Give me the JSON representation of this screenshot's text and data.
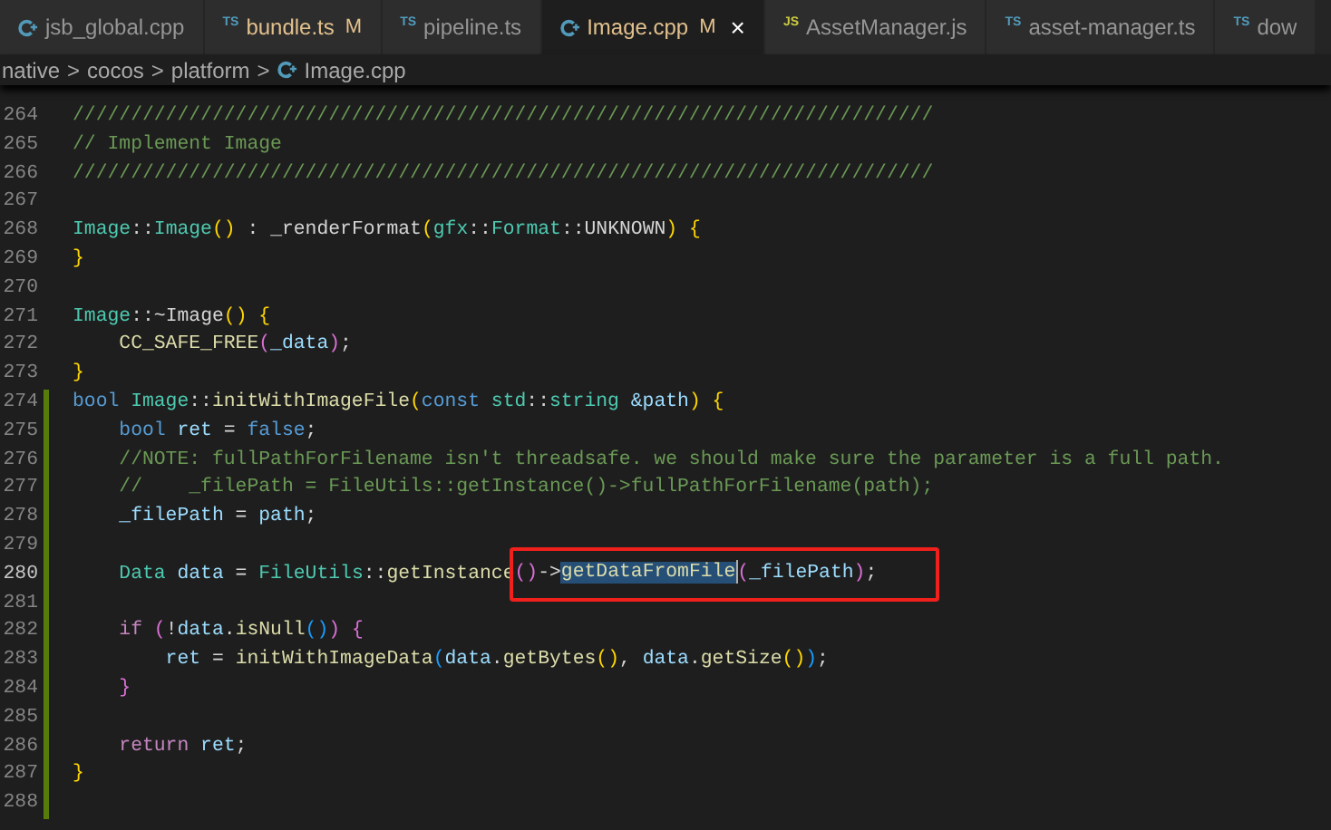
{
  "tabs": [
    {
      "kind": "cpp",
      "label": "jsb_global.cpp",
      "modified": false,
      "selected": false
    },
    {
      "kind": "ts",
      "icon_text": "TS",
      "label": "bundle.ts",
      "modified": true,
      "mark": "M",
      "selected": false
    },
    {
      "kind": "ts",
      "icon_text": "TS",
      "label": "pipeline.ts",
      "modified": false,
      "selected": false
    },
    {
      "kind": "cpp",
      "label": "Image.cpp",
      "modified": true,
      "mark": "M",
      "close": "×",
      "selected": true
    },
    {
      "kind": "js",
      "icon_text": "JS",
      "label": "AssetManager.js",
      "modified": false,
      "selected": false
    },
    {
      "kind": "ts",
      "icon_text": "TS",
      "label": "asset-manager.ts",
      "modified": false,
      "selected": false
    },
    {
      "kind": "ts",
      "icon_text": "TS",
      "label": "dow",
      "modified": false,
      "selected": false
    }
  ],
  "breadcrumb": [
    {
      "kind": "folder",
      "label": "native"
    },
    {
      "kind": "folder",
      "label": "cocos"
    },
    {
      "kind": "folder",
      "label": "platform"
    },
    {
      "kind": "cpp",
      "label": "Image.cpp"
    }
  ],
  "editor": {
    "separator": ">",
    "lines": [
      {
        "number": "264",
        "current": false,
        "modified": false,
        "tokens": [
          {
            "kind": "comment",
            "text": "//////////////////////////////////////////////////////////////////////////"
          }
        ]
      },
      {
        "number": "265",
        "current": false,
        "modified": false,
        "tokens": [
          {
            "kind": "comment",
            "text": "// Implement Image"
          }
        ]
      },
      {
        "number": "266",
        "current": false,
        "modified": false,
        "tokens": [
          {
            "kind": "comment",
            "text": "//////////////////////////////////////////////////////////////////////////"
          }
        ]
      },
      {
        "number": "267",
        "current": false,
        "modified": false
      },
      {
        "number": "268",
        "current": false,
        "modified": false,
        "tokens": [
          {
            "kind": "type",
            "text": "Image"
          },
          {
            "kind": "p",
            "text": "::"
          },
          {
            "kind": "type",
            "text": "Image"
          },
          {
            "kind": "b1",
            "text": "()"
          },
          {
            "kind": "p",
            "text": " : "
          },
          {
            "kind": "plain",
            "text": "_renderFormat"
          },
          {
            "kind": "b1",
            "text": "("
          },
          {
            "kind": "type",
            "text": "gfx"
          },
          {
            "kind": "p",
            "text": "::"
          },
          {
            "kind": "type",
            "text": "Format"
          },
          {
            "kind": "p",
            "text": "::"
          },
          {
            "kind": "plain",
            "text": "UNKNOWN"
          },
          {
            "kind": "b1",
            "text": ")"
          },
          {
            "kind": "b1",
            "text": " {"
          }
        ]
      },
      {
        "number": "269",
        "current": false,
        "modified": false,
        "tokens": [
          {
            "kind": "b1",
            "text": "}"
          }
        ]
      },
      {
        "number": "270",
        "current": false,
        "modified": false
      },
      {
        "number": "271",
        "current": false,
        "modified": false,
        "tokens": [
          {
            "kind": "type",
            "text": "Image"
          },
          {
            "kind": "p",
            "text": "::~"
          },
          {
            "kind": "plain",
            "text": "Image"
          },
          {
            "kind": "b1",
            "text": "()"
          },
          {
            "kind": "b1",
            "text": " {"
          }
        ]
      },
      {
        "number": "272",
        "current": false,
        "modified": false,
        "tokens": [
          {
            "kind": "fn",
            "text": "    CC_SAFE_FREE"
          },
          {
            "kind": "b2",
            "text": "("
          },
          {
            "kind": "var",
            "text": "_data"
          },
          {
            "kind": "b2",
            "text": ")"
          },
          {
            "kind": "p",
            "text": ";"
          }
        ]
      },
      {
        "number": "273",
        "current": false,
        "modified": false,
        "tokens": [
          {
            "kind": "b1",
            "text": "}"
          }
        ]
      },
      {
        "number": "274",
        "current": false,
        "modified": true,
        "tokens": [
          {
            "kind": "kw",
            "text": "bool"
          },
          {
            "kind": "type",
            "text": " Image"
          },
          {
            "kind": "p",
            "text": "::"
          },
          {
            "kind": "fn",
            "text": "initWithImageFile"
          },
          {
            "kind": "b1",
            "text": "("
          },
          {
            "kind": "kw",
            "text": "const"
          },
          {
            "kind": "type",
            "text": " std"
          },
          {
            "kind": "p",
            "text": "::"
          },
          {
            "kind": "type",
            "text": "string"
          },
          {
            "kind": "var",
            "text": " &path"
          },
          {
            "kind": "b1",
            "text": ")"
          },
          {
            "kind": "b1",
            "text": " {"
          }
        ]
      },
      {
        "number": "275",
        "current": false,
        "modified": true,
        "tokens": [
          {
            "kind": "kw",
            "text": "    bool"
          },
          {
            "kind": "var",
            "text": " ret"
          },
          {
            "kind": "p",
            "text": " = "
          },
          {
            "kind": "kw",
            "text": "false"
          },
          {
            "kind": "p",
            "text": ";"
          }
        ]
      },
      {
        "number": "276",
        "current": false,
        "modified": true,
        "tokens": [
          {
            "kind": "comment",
            "text": "    //NOTE: fullPathForFilename isn't threadsafe. we should make sure the parameter is a full path."
          }
        ]
      },
      {
        "number": "277",
        "current": false,
        "modified": true,
        "tokens": [
          {
            "kind": "comment",
            "text": "    //    _filePath = FileUtils::getInstance()->fullPathForFilename(path);"
          }
        ]
      },
      {
        "number": "278",
        "current": false,
        "modified": true,
        "tokens": [
          {
            "kind": "var",
            "text": "    _filePath"
          },
          {
            "kind": "p",
            "text": " = "
          },
          {
            "kind": "var",
            "text": "path"
          },
          {
            "kind": "p",
            "text": ";"
          }
        ]
      },
      {
        "number": "279",
        "current": false,
        "modified": true
      },
      {
        "number": "280",
        "current": true,
        "modified": true,
        "tokens": [
          {
            "kind": "type",
            "text": "    Data"
          },
          {
            "kind": "var",
            "text": " data"
          },
          {
            "kind": "p",
            "text": " = "
          },
          {
            "kind": "type",
            "text": "FileUtils"
          },
          {
            "kind": "p",
            "text": "::"
          },
          {
            "kind": "fn",
            "text": "getInstance"
          }
        ],
        "boxed_tokens": [
          {
            "kind": "b2",
            "text": "()"
          },
          {
            "kind": "p",
            "text": "->"
          },
          {
            "kind": "fn",
            "text": "getDataFromFile",
            "selected": true,
            "cursor_after": true
          },
          {
            "kind": "b2",
            "text": "("
          },
          {
            "kind": "var",
            "text": "_filePath"
          },
          {
            "kind": "b2",
            "text": ")"
          },
          {
            "kind": "p",
            "text": ";"
          }
        ]
      },
      {
        "number": "281",
        "current": false,
        "modified": true
      },
      {
        "number": "282",
        "current": false,
        "modified": true,
        "tokens": [
          {
            "kind": "ctrl",
            "text": "    if"
          },
          {
            "kind": "b2",
            "text": " ("
          },
          {
            "kind": "p",
            "text": "!"
          },
          {
            "kind": "var",
            "text": "data"
          },
          {
            "kind": "p",
            "text": "."
          },
          {
            "kind": "fn",
            "text": "isNull"
          },
          {
            "kind": "b3",
            "text": "()"
          },
          {
            "kind": "b2",
            "text": ")"
          },
          {
            "kind": "b2",
            "text": " {"
          }
        ]
      },
      {
        "number": "283",
        "current": false,
        "modified": true,
        "tokens": [
          {
            "kind": "var",
            "text": "        ret"
          },
          {
            "kind": "p",
            "text": " = "
          },
          {
            "kind": "fn",
            "text": "initWithImageData"
          },
          {
            "kind": "b3",
            "text": "("
          },
          {
            "kind": "var",
            "text": "data"
          },
          {
            "kind": "p",
            "text": "."
          },
          {
            "kind": "fn",
            "text": "getBytes"
          },
          {
            "kind": "b1",
            "text": "()"
          },
          {
            "kind": "p",
            "text": ", "
          },
          {
            "kind": "var",
            "text": "data"
          },
          {
            "kind": "p",
            "text": "."
          },
          {
            "kind": "fn",
            "text": "getSize"
          },
          {
            "kind": "b1",
            "text": "()"
          },
          {
            "kind": "b3",
            "text": ")"
          },
          {
            "kind": "p",
            "text": ";"
          }
        ]
      },
      {
        "number": "284",
        "current": false,
        "modified": true,
        "tokens": [
          {
            "kind": "b2",
            "text": "    }"
          }
        ]
      },
      {
        "number": "285",
        "current": false,
        "modified": true
      },
      {
        "number": "286",
        "current": false,
        "modified": true,
        "tokens": [
          {
            "kind": "ctrl",
            "text": "    return"
          },
          {
            "kind": "var",
            "text": " ret"
          },
          {
            "kind": "p",
            "text": ";"
          }
        ]
      },
      {
        "number": "287",
        "current": false,
        "modified": true,
        "tokens": [
          {
            "kind": "b1",
            "text": "}"
          }
        ]
      },
      {
        "number": "288",
        "current": false,
        "modified": true
      }
    ]
  }
}
